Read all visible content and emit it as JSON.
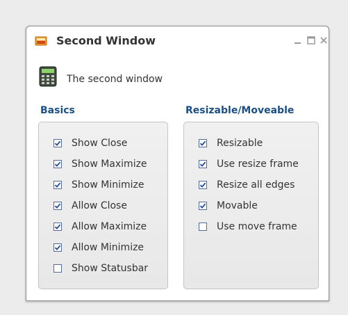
{
  "window": {
    "title": "Second Window",
    "controls": [
      "minimize",
      "maximize",
      "close"
    ],
    "intro_text": "The second window"
  },
  "groups": {
    "basics": {
      "title": "Basics",
      "items": [
        {
          "label": "Show Close",
          "checked": true
        },
        {
          "label": "Show Maximize",
          "checked": true
        },
        {
          "label": "Show Minimize",
          "checked": true
        },
        {
          "label": "Allow Close",
          "checked": true
        },
        {
          "label": "Allow Maximize",
          "checked": true
        },
        {
          "label": "Allow Minimize",
          "checked": true
        },
        {
          "label": "Show Statusbar",
          "checked": false
        }
      ]
    },
    "resizable": {
      "title": "Resizable/Moveable",
      "items": [
        {
          "label": "Resizable",
          "checked": true
        },
        {
          "label": "Use resize frame",
          "checked": true
        },
        {
          "label": "Resize all edges",
          "checked": true
        },
        {
          "label": "Movable",
          "checked": true
        },
        {
          "label": "Use move frame",
          "checked": false
        }
      ]
    }
  },
  "colors": {
    "group_title": "#1c4f86",
    "checkbox_border": "#506b9d",
    "window_bg": "#ffffff",
    "page_bg": "#ececec"
  },
  "icons": {
    "title": "window-app-icon",
    "intro": "calculator-icon"
  }
}
